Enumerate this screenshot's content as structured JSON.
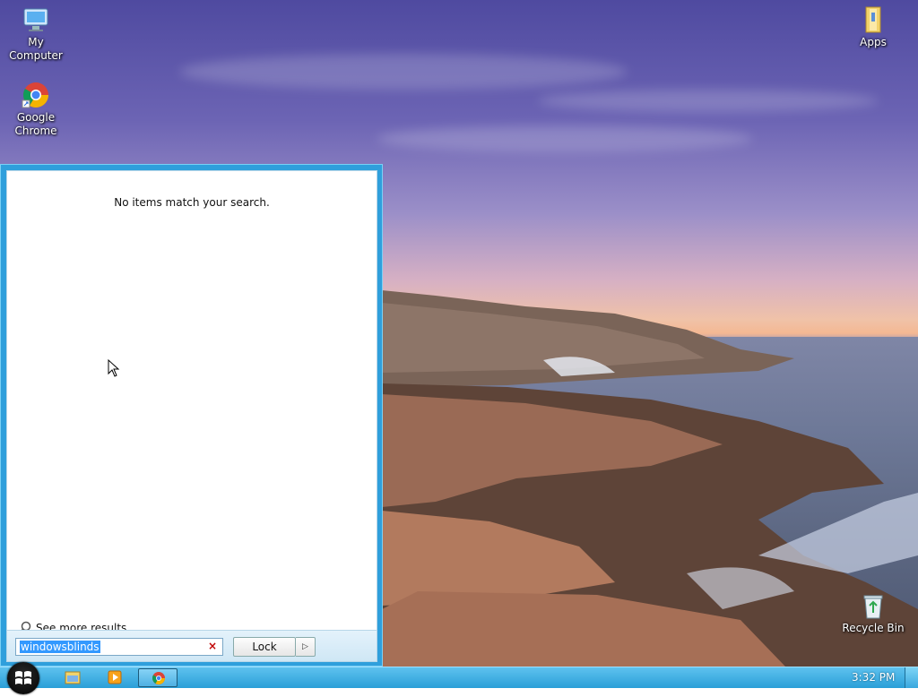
{
  "desktop": {
    "icons": [
      {
        "label": "My Computer",
        "icon": "my-computer-icon"
      },
      {
        "label": "Google\nChrome",
        "icon": "chrome-icon"
      },
      {
        "label": "Apps",
        "icon": "folder-icon"
      },
      {
        "label": "Recycle Bin",
        "icon": "recycle-bin-icon"
      }
    ]
  },
  "start_menu": {
    "no_results": "No items match your search.",
    "see_more": "See more results",
    "search_value": "windowsblinds",
    "clear_glyph": "×",
    "lock_label": "Lock",
    "lock_arrow": "▷"
  },
  "taskbar": {
    "clock": "3:32 PM",
    "buttons": [
      "file-explorer-icon",
      "media-player-icon",
      "chrome-icon"
    ],
    "active": "chrome-icon"
  },
  "colors": {
    "taskbar": "#2a9fd8",
    "start_menu_frame": "#2f9fdc",
    "selection": "#3399ff"
  }
}
